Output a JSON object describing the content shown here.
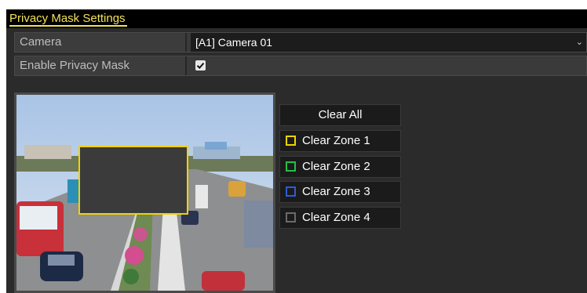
{
  "page": {
    "title": "Privacy Mask Settings"
  },
  "form": {
    "camera_label": "Camera",
    "camera_value": "[A1] Camera 01",
    "enable_label": "Enable Privacy Mask",
    "enable_checked": true
  },
  "buttons": {
    "clear_all": "Clear All",
    "zones": [
      {
        "label": "Clear Zone 1",
        "color": "#f2d200"
      },
      {
        "label": "Clear Zone 2",
        "color": "#23c04a"
      },
      {
        "label": "Clear Zone 3",
        "color": "#2f5bd6"
      },
      {
        "label": "Clear Zone 4",
        "color": "#6a6a6a"
      }
    ]
  },
  "icons": {
    "dropdown": "chevron-down-icon",
    "checkbox": "checkmark-icon"
  }
}
